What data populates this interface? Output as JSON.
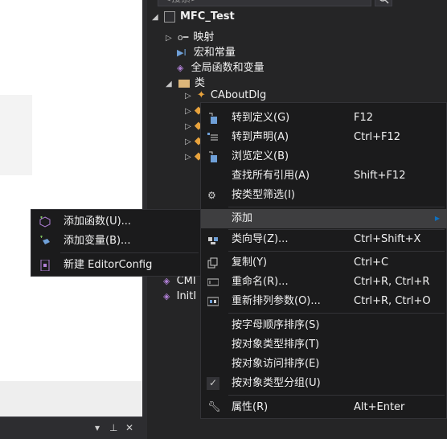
{
  "search": {
    "placeholder": "<搜索>"
  },
  "tree": {
    "project": "MFC_Test",
    "nodes": [
      {
        "label": "映射",
        "icon": "map-icon"
      },
      {
        "label": "宏和常量",
        "icon": "macro-icon"
      },
      {
        "label": "全局函数和变量",
        "icon": "global-icon"
      },
      {
        "label": "类",
        "icon": "folder-icon"
      }
    ],
    "selected_class": "CAboutDlg",
    "partial_items": [
      "CMI",
      "InitI"
    ]
  },
  "context_menu": {
    "items": [
      {
        "label": "转到定义(G)",
        "shortcut": "F12",
        "icon": "goto-definition-icon"
      },
      {
        "label": "转到声明(A)",
        "shortcut": "Ctrl+F12",
        "icon": "goto-declaration-icon"
      },
      {
        "label": "浏览定义(B)",
        "shortcut": "",
        "icon": "browse-definition-icon"
      },
      {
        "label": "查找所有引用(A)",
        "shortcut": "Shift+F12",
        "icon": ""
      },
      {
        "label": "按类型筛选(I)",
        "shortcut": "",
        "icon": "filter-type-icon"
      },
      {
        "label": "添加",
        "shortcut": "",
        "icon": ""
      },
      {
        "label": "类向导(Z)...",
        "shortcut": "Ctrl+Shift+X",
        "icon": "class-wizard-icon"
      },
      {
        "label": "复制(Y)",
        "shortcut": "Ctrl+C",
        "icon": "copy-icon"
      },
      {
        "label": "重命名(R)...",
        "shortcut": "Ctrl+R, Ctrl+R",
        "icon": "rename-icon"
      },
      {
        "label": "重新排列参数(O)...",
        "shortcut": "Ctrl+R, Ctrl+O",
        "icon": "reorder-params-icon"
      },
      {
        "label": "按字母顺序排序(S)",
        "shortcut": "",
        "icon": ""
      },
      {
        "label": "按对象类型排序(T)",
        "shortcut": "",
        "icon": ""
      },
      {
        "label": "按对象访问排序(E)",
        "shortcut": "",
        "icon": ""
      },
      {
        "label": "按对象类型分组(U)",
        "shortcut": "",
        "icon": "check-icon"
      },
      {
        "label": "属性(R)",
        "shortcut": "Alt+Enter",
        "icon": "wrench-icon"
      }
    ]
  },
  "submenu": {
    "items": [
      {
        "label": "添加函数(U)...",
        "icon": "add-function-icon"
      },
      {
        "label": "添加变量(B)...",
        "icon": "add-variable-icon"
      },
      {
        "label": "新建 EditorConfig",
        "icon": "editorconfig-icon"
      }
    ]
  },
  "bottom_panel": {
    "pin": "▾ ⊥ ✕"
  },
  "colors": {
    "accent": "#0e70c0",
    "menu_bg": "#1b1b1c",
    "highlight": "#3e3e40",
    "panel_bg": "#252526"
  }
}
